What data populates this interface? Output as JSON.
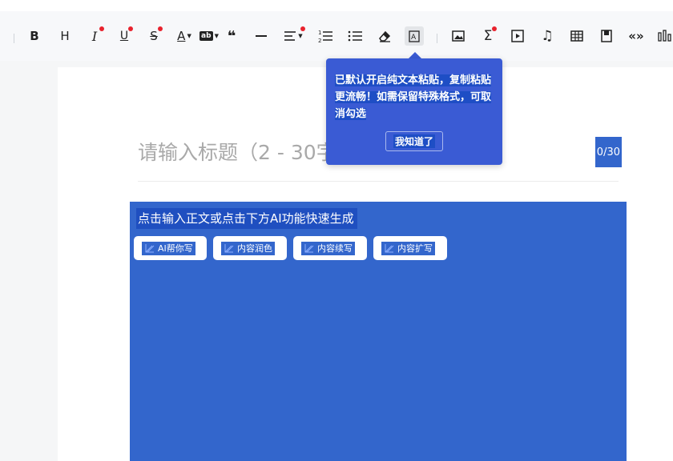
{
  "toolbar": {
    "items": [
      {
        "name": "bold-button",
        "glyph": "B"
      },
      {
        "name": "heading-button",
        "glyph": "H"
      },
      {
        "name": "italic-button",
        "glyph": "I"
      },
      {
        "name": "underline-button",
        "glyph": "U"
      },
      {
        "name": "strikethrough-button",
        "glyph": "S"
      },
      {
        "name": "font-color-button",
        "glyph": "A"
      },
      {
        "name": "highlight-button",
        "glyph": "ab"
      },
      {
        "name": "quote-button",
        "glyph": "❝"
      }
    ],
    "notification_color": "#e8222d"
  },
  "title": {
    "placeholder": "请输入标题（2 - 30字）",
    "counter": "0/30"
  },
  "body": {
    "placeholder": "点击输入正文或点击下方AI功能快速生成"
  },
  "ai_buttons": [
    {
      "label": "AI帮你写"
    },
    {
      "label": "内容润色"
    },
    {
      "label": "内容续写"
    },
    {
      "label": "内容扩写"
    }
  ],
  "tooltip": {
    "message": "已默认开启纯文本粘贴，复制粘贴更流畅！如需保留特殊格式，可取消勾选",
    "confirm": "我知道了"
  },
  "colors": {
    "accent": "#3366cc",
    "tooltip_bg": "#3a5bd4",
    "placeholder": "#a9a9a9"
  }
}
